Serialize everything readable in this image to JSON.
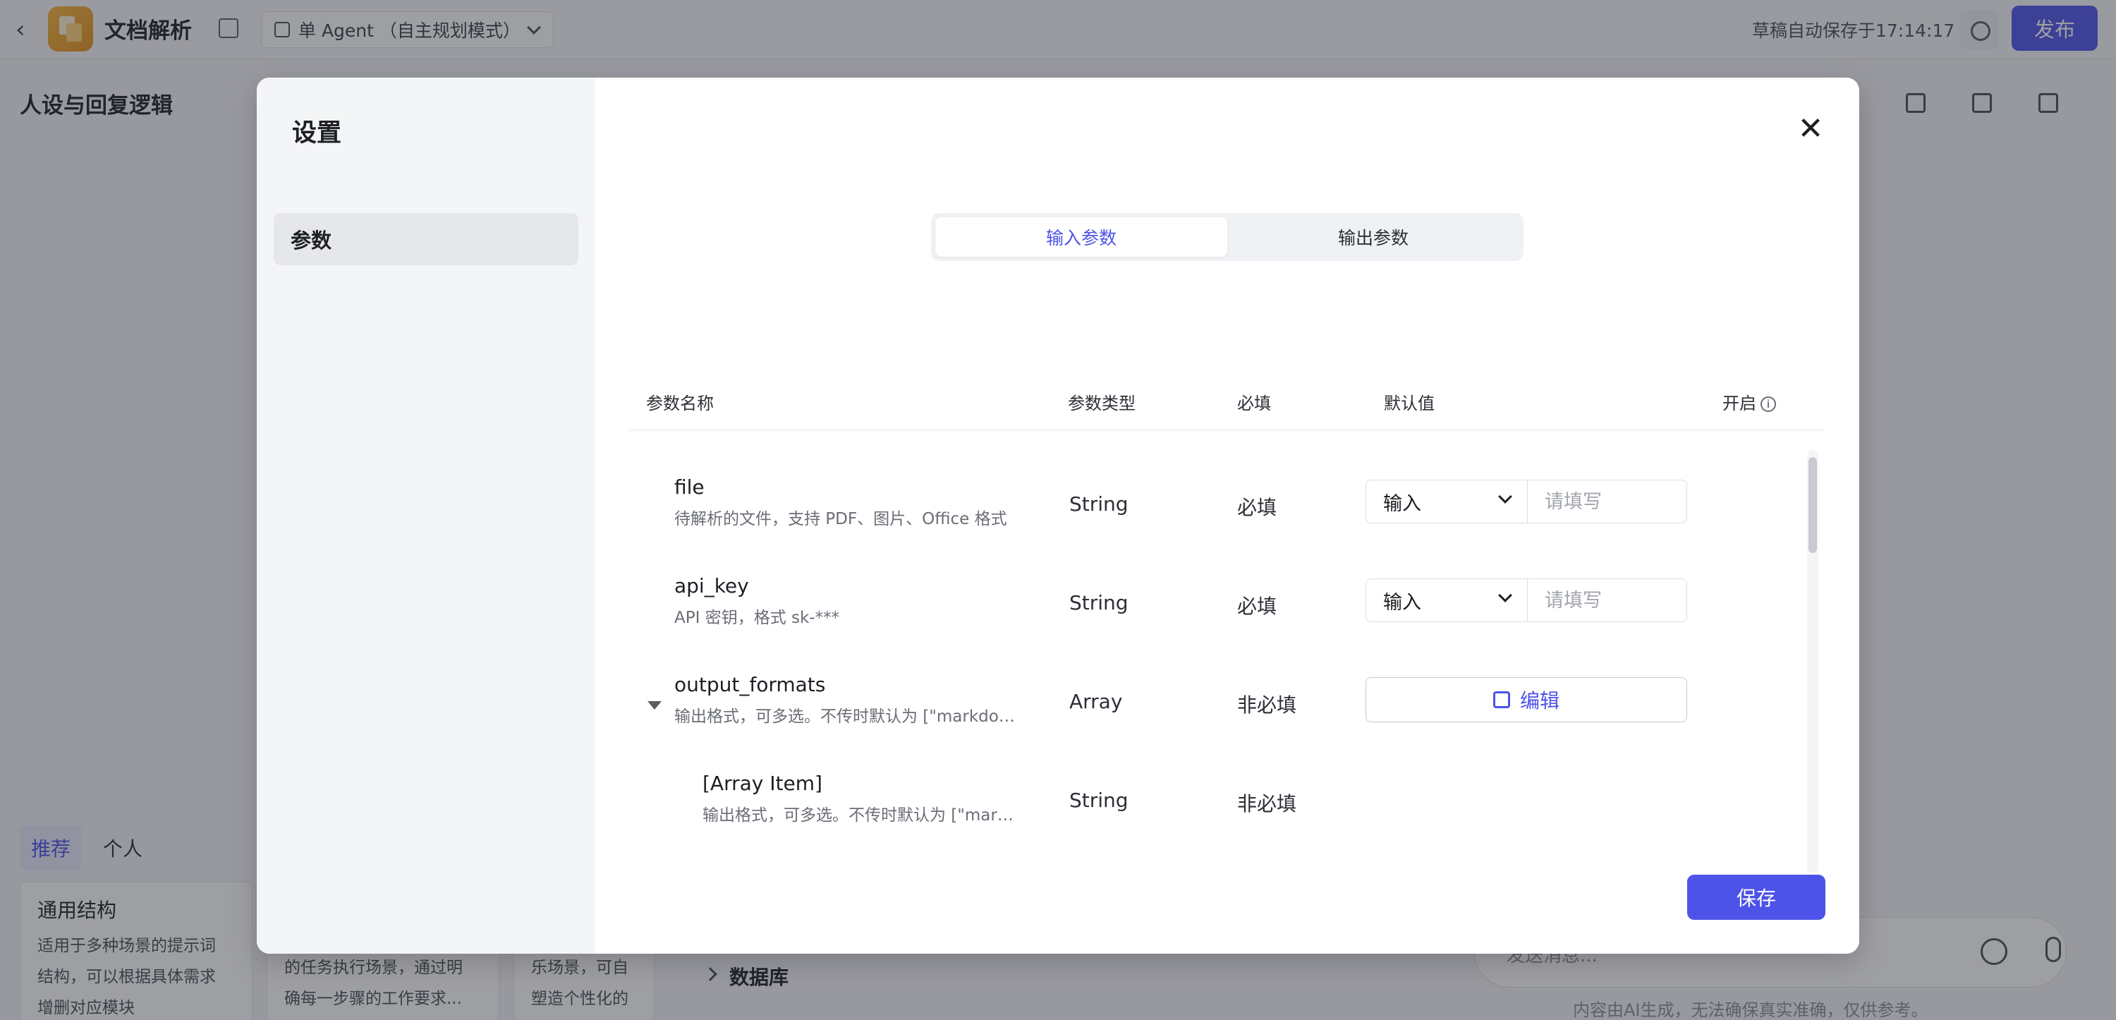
{
  "header": {
    "app_title": "文档解析",
    "agent_mode": "单 Agent （自主规划模式）",
    "autosave": "草稿自动保存于17:14:17",
    "publish_label": "发布"
  },
  "left_panel": {
    "title": "人设与回复逻辑",
    "tabs": [
      "推荐",
      "个人"
    ],
    "cards": [
      {
        "title": "通用结构",
        "lines": [
          "适用于多种场景的提示词",
          "结构，可以根据具体需求",
          "增删对应模块"
        ]
      },
      {
        "title": "",
        "lines": [
          "的任务执行场景，通过明",
          "确每一步骤的工作要求..."
        ]
      },
      {
        "title": "",
        "lines": [
          "乐场景，可自",
          "塑造个性化的人"
        ]
      }
    ]
  },
  "middle": {
    "database_label": "数据库"
  },
  "chat": {
    "placeholder": "发送消息...",
    "footer": "内容由AI生成，无法确保真实准确，仅供参考。"
  },
  "modal": {
    "title": "设置",
    "side_items": [
      "参数"
    ],
    "segments": [
      "输入参数",
      "输出参数"
    ],
    "columns": {
      "name": "参数名称",
      "type": "参数类型",
      "required": "必填",
      "default": "默认值",
      "enabled": "开启"
    },
    "rows": [
      {
        "name": "file",
        "desc": "待解析的文件，支持 PDF、图片、Office 格式",
        "type": "String",
        "required": "必填",
        "select": "输入",
        "placeholder": "请填写"
      },
      {
        "name": "api_key",
        "desc": "API 密钥，格式 sk-***",
        "type": "String",
        "required": "必填",
        "select": "输入",
        "placeholder": "请填写"
      },
      {
        "name": "output_formats",
        "desc": "输出格式，可多选。不传时默认为 [\"markdown\"]",
        "type": "Array",
        "required": "非必填",
        "edit_label": "编辑"
      },
      {
        "name": "[Array Item]",
        "desc": "输出格式，可多选。不传时默认为 [\"markdown\"]",
        "type": "String",
        "required": "非必填"
      }
    ],
    "save_label": "保存"
  },
  "colors": {
    "accent": "#4d53e8",
    "toggle_on": "#4caf50"
  }
}
